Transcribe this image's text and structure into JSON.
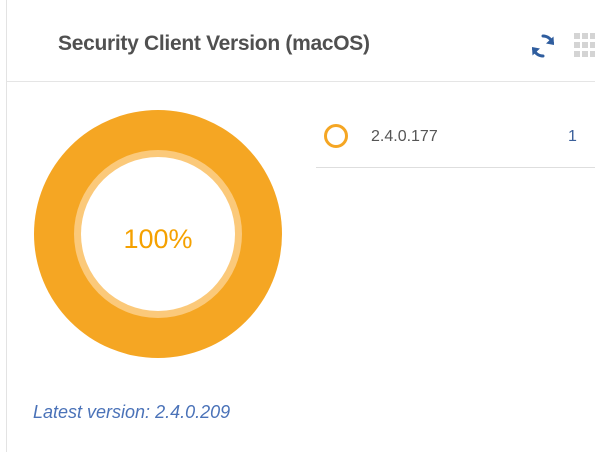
{
  "widget": {
    "title": "Security Client Version (macOS)",
    "actions": {
      "refresh_icon": "refresh-icon",
      "drag_icon": "drag-grid-icon"
    },
    "accent_color": "#f5a623",
    "link_color": "#4a72b8"
  },
  "chart_data": {
    "type": "pie",
    "center_label": "100%",
    "categories": [
      "2.4.0.177"
    ],
    "values": [
      1
    ],
    "colors": [
      "#f5a623"
    ],
    "legend_position": "right"
  },
  "legend": {
    "items": [
      {
        "label": "2.4.0.177",
        "count": "1",
        "color": "#f5a623"
      }
    ]
  },
  "footer": {
    "latest_version": "Latest version: 2.4.0.209"
  }
}
